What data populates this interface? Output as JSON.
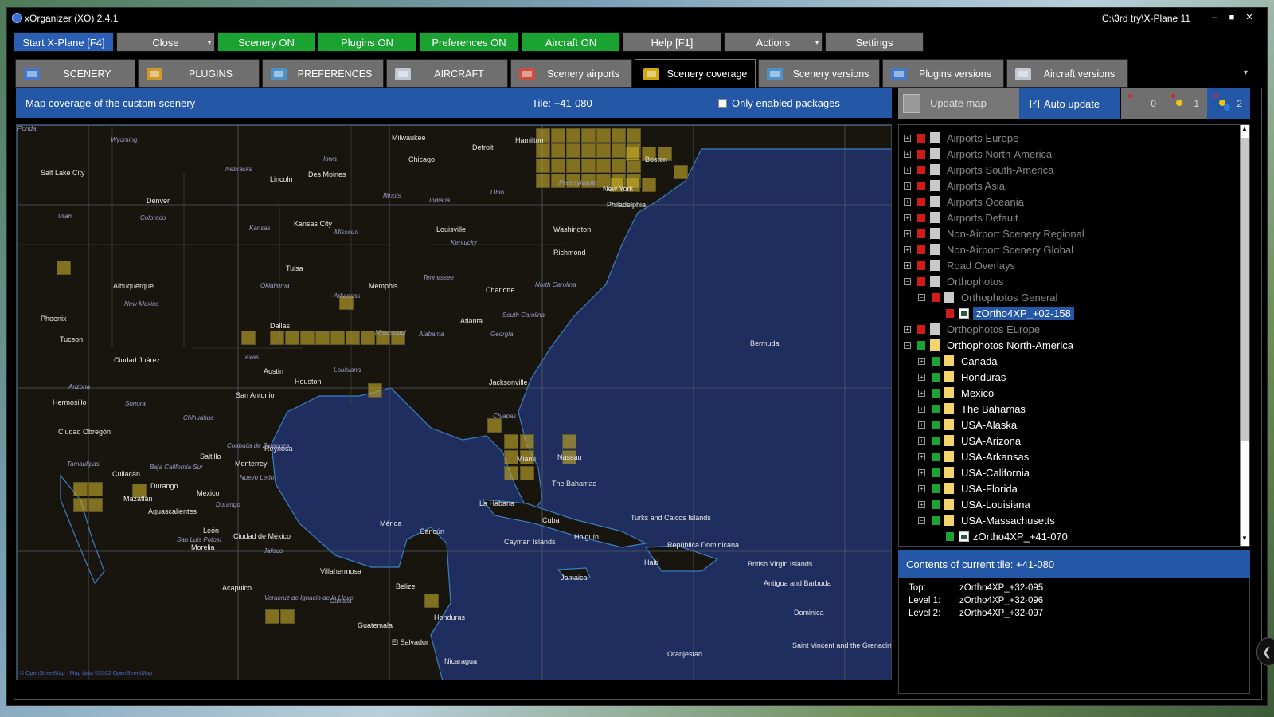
{
  "window": {
    "title": "xOrganizer (XO) 2.4.1",
    "path": "C:\\3rd try\\X-Plane 11",
    "controls": {
      "minimize": "–",
      "maximize": "■",
      "close": "✕"
    }
  },
  "toolbar": {
    "start": "Start X-Plane [F4]",
    "close": "Close",
    "scenery_on": "Scenery ON",
    "plugins_on": "Plugins ON",
    "preferences_on": "Preferences ON",
    "aircraft_on": "Aircraft ON",
    "help": "Help [F1]",
    "actions": "Actions",
    "settings": "Settings",
    "colors": {
      "blue": "#2a5fb4",
      "green": "#1aa330",
      "gray": "#6f6f6f"
    }
  },
  "tabs": [
    {
      "label": "SCENERY",
      "icon": "scenery-icon"
    },
    {
      "label": "PLUGINS",
      "icon": "plugins-icon"
    },
    {
      "label": "PREFERENCES",
      "icon": "preferences-icon"
    },
    {
      "label": "AIRCRAFT",
      "icon": "aircraft-icon"
    },
    {
      "label": "Scenery airports",
      "icon": "scenery-airports-icon"
    },
    {
      "label": "Scenery coverage",
      "icon": "scenery-coverage-icon",
      "active": true
    },
    {
      "label": "Scenery versions",
      "icon": "scenery-versions-icon"
    },
    {
      "label": "Plugins versions",
      "icon": "plugins-versions-icon"
    },
    {
      "label": "Aircraft versions",
      "icon": "aircraft-versions-icon"
    }
  ],
  "map_panel": {
    "title": "Map coverage of the custom scenery",
    "tile": "Tile: +41-080",
    "only_enabled": "Only enabled packages",
    "only_enabled_checked": false,
    "attribution": "© OpenStreetMap · Map data ©2022 OpenStreetMap"
  },
  "map_labels": {
    "cities": [
      "Salt Lake City",
      "Denver",
      "Lincoln",
      "Des Moines",
      "Chicago",
      "Milwaukee",
      "Detroit",
      "Hamilton",
      "Boston",
      "New York",
      "Philadelphia",
      "Washington",
      "Richmond",
      "Kansas City",
      "Louisville",
      "Tulsa",
      "Memphis",
      "Charlotte",
      "Albuquerque",
      "Phoenix",
      "Tucson",
      "Ciudad Juárez",
      "Dallas",
      "Atlanta",
      "Austin",
      "Houston",
      "San Antonio",
      "Jacksonville",
      "Hermosillo",
      "Ciudad Obregón",
      "Saltillo",
      "Reynosa",
      "Monterrey",
      "Culiacán",
      "Durango",
      "Mazatlán",
      "México",
      "Aguascalientes",
      "León",
      "Morelia",
      "Ciudad de México",
      "Villahermosa",
      "Acapulco",
      "Mérida",
      "Cancún",
      "La Habana",
      "Cuba",
      "Miami",
      "Nassau",
      "The Bahamas",
      "Bermuda",
      "Turks and Caicos Islands",
      "Holguín",
      "Cayman Islands",
      "Jamaica",
      "República Dominicana",
      "British Virgin Islands",
      "Antigua and Barbuda",
      "Dominica",
      "Saint Vincent and the Grenadines",
      "Belize",
      "Guatemala",
      "Honduras",
      "El Salvador",
      "Nicaragua",
      "Oranjestad",
      "Haiti"
    ],
    "states": [
      "Wyoming",
      "Nebraska",
      "Iowa",
      "Illinois",
      "Indiana",
      "Ohio",
      "Pennsylvania",
      "Utah",
      "Colorado",
      "Kansas",
      "Missouri",
      "Kentucky",
      "Oklahoma",
      "Arkansas",
      "Tennessee",
      "North Carolina",
      "South Carolina",
      "Georgia",
      "Alabama",
      "Mississippi",
      "Louisiana",
      "Texas",
      "New Mexico",
      "Arizona",
      "Sonora",
      "Chihuahua",
      "Coahuila de Zaragoza",
      "Nuevo León",
      "Tamaulipas",
      "Baja California Sur",
      "Durango",
      "San Luis Potosí",
      "Jalisco",
      "Veracruz de Ignacio de la Llave",
      "Oaxaca",
      "Chiapas",
      "Florida"
    ]
  },
  "right_panel": {
    "update_map": "Update map",
    "auto_update": "Auto update",
    "auto_update_checked": true,
    "levels": [
      {
        "count": "0",
        "dots": [
          "#d9232a"
        ]
      },
      {
        "count": "1",
        "dots": [
          "#d9232a",
          "#f2c40f"
        ]
      },
      {
        "count": "2",
        "dots": [
          "#d9232a",
          "#f2c40f",
          "#2a7fd4"
        ],
        "selected": true
      }
    ]
  },
  "tree": [
    {
      "label": "Airports Europe",
      "depth": 0,
      "expander": "+",
      "status": "red",
      "folder": "gray"
    },
    {
      "label": "Airports North-America",
      "depth": 0,
      "expander": "+",
      "status": "red",
      "folder": "gray"
    },
    {
      "label": "Airports South-America",
      "depth": 0,
      "expander": "+",
      "status": "red",
      "folder": "gray"
    },
    {
      "label": "Airports Asia",
      "depth": 0,
      "expander": "+",
      "status": "red",
      "folder": "gray"
    },
    {
      "label": "Airports Oceania",
      "depth": 0,
      "expander": "+",
      "status": "red",
      "folder": "gray"
    },
    {
      "label": "Airports Default",
      "depth": 0,
      "expander": "+",
      "status": "red",
      "folder": "gray"
    },
    {
      "label": "Non-Airport Scenery Regional",
      "depth": 0,
      "expander": "+",
      "status": "red",
      "folder": "gray"
    },
    {
      "label": "Non-Airport Scenery Global",
      "depth": 0,
      "expander": "+",
      "status": "red",
      "folder": "gray"
    },
    {
      "label": "Road Overlays",
      "depth": 0,
      "expander": "+",
      "status": "red",
      "folder": "gray"
    },
    {
      "label": "Orthophotos",
      "depth": 0,
      "expander": "−",
      "status": "red",
      "folder": "gray"
    },
    {
      "label": "Orthophotos General",
      "depth": 1,
      "expander": "−",
      "status": "red",
      "folder": "gray"
    },
    {
      "label": "zOrtho4XP_+02-158",
      "depth": 2,
      "expander": "",
      "status": "red",
      "folder": "pkg",
      "selected": true
    },
    {
      "label": "Orthophotos Europe",
      "depth": 0,
      "expander": "+",
      "status": "red",
      "folder": "gray"
    },
    {
      "label": "Orthophotos North-America",
      "depth": 0,
      "expander": "−",
      "status": "green",
      "folder": "yellow"
    },
    {
      "label": "Canada",
      "depth": 1,
      "expander": "+",
      "status": "green",
      "folder": "yellow"
    },
    {
      "label": "Honduras",
      "depth": 1,
      "expander": "+",
      "status": "green",
      "folder": "yellow"
    },
    {
      "label": "Mexico",
      "depth": 1,
      "expander": "+",
      "status": "green",
      "folder": "yellow"
    },
    {
      "label": "The Bahamas",
      "depth": 1,
      "expander": "+",
      "status": "green",
      "folder": "yellow"
    },
    {
      "label": "USA-Alaska",
      "depth": 1,
      "expander": "+",
      "status": "green",
      "folder": "yellow"
    },
    {
      "label": "USA-Arizona",
      "depth": 1,
      "expander": "+",
      "status": "green",
      "folder": "yellow"
    },
    {
      "label": "USA-Arkansas",
      "depth": 1,
      "expander": "+",
      "status": "green",
      "folder": "yellow"
    },
    {
      "label": "USA-California",
      "depth": 1,
      "expander": "+",
      "status": "green",
      "folder": "yellow"
    },
    {
      "label": "USA-Florida",
      "depth": 1,
      "expander": "+",
      "status": "green",
      "folder": "yellow"
    },
    {
      "label": "USA-Louisiana",
      "depth": 1,
      "expander": "+",
      "status": "green",
      "folder": "yellow"
    },
    {
      "label": "USA-Massachusetts",
      "depth": 1,
      "expander": "−",
      "status": "green",
      "folder": "yellow"
    },
    {
      "label": "zOrtho4XP_+41-070",
      "depth": 2,
      "expander": "",
      "status": "green",
      "folder": "pkg"
    }
  ],
  "contents": {
    "header": "Contents of current tile: +41-080",
    "rows": [
      {
        "key": "Top:",
        "value": "zOrtho4XP_+32-095"
      },
      {
        "key": "Level 1:",
        "value": "zOrtho4XP_+32-096"
      },
      {
        "key": "Level 2:",
        "value": "zOrtho4XP_+32-097"
      }
    ]
  },
  "status_colors": {
    "red": "#d11a1a",
    "green": "#1aa330",
    "gray": "#c9c9c9",
    "yellow": "#f2d66b"
  }
}
